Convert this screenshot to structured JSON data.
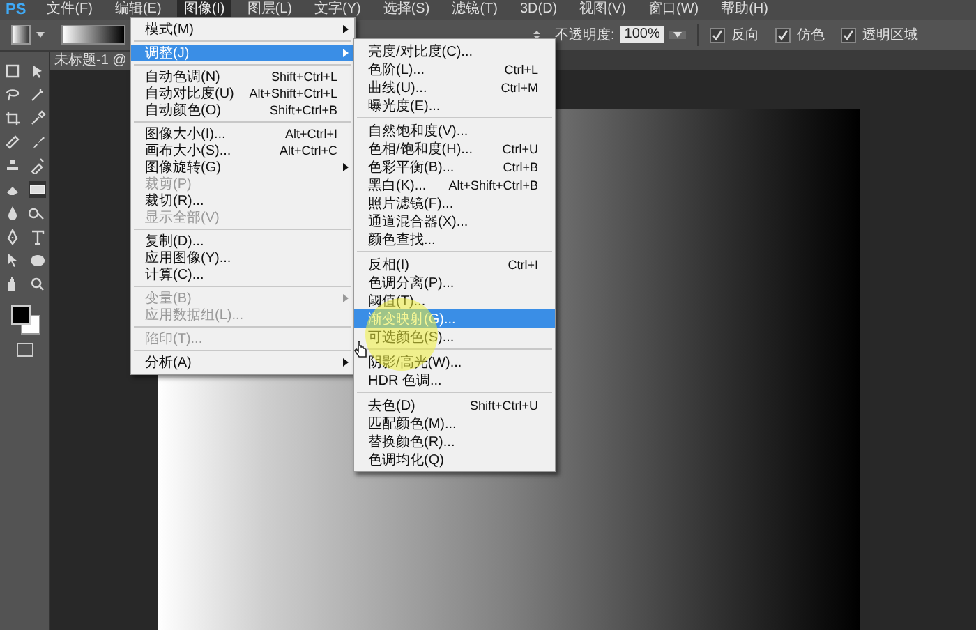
{
  "app_logo": "PS",
  "menu_bar": [
    {
      "label": "文件(F)",
      "selected": false
    },
    {
      "label": "编辑(E)",
      "selected": false
    },
    {
      "label": "图像(I)",
      "selected": true
    },
    {
      "label": "图层(L)",
      "selected": false
    },
    {
      "label": "文字(Y)",
      "selected": false
    },
    {
      "label": "选择(S)",
      "selected": false
    },
    {
      "label": "滤镜(T)",
      "selected": false
    },
    {
      "label": "3D(D)",
      "selected": false
    },
    {
      "label": "视图(V)",
      "selected": false
    },
    {
      "label": "窗口(W)",
      "selected": false
    },
    {
      "label": "帮助(H)",
      "selected": false
    }
  ],
  "options_bar": {
    "opacity_label": "不透明度:",
    "opacity_value": "100%",
    "checkboxes": [
      {
        "label": "反向",
        "checked": true
      },
      {
        "label": "仿色",
        "checked": true
      },
      {
        "label": "透明区域",
        "checked": true
      }
    ]
  },
  "document_tab": {
    "title": "未标题-1 @"
  },
  "image_menu": {
    "items": [
      {
        "label": "模式(M)",
        "submenu": true,
        "disabled": false,
        "selected": false
      },
      {
        "kind": "separator"
      },
      {
        "label": "调整(J)",
        "submenu": true,
        "disabled": false,
        "selected": true
      },
      {
        "kind": "separator"
      },
      {
        "label": "自动色调(N)",
        "shortcut": "Shift+Ctrl+L",
        "disabled": false,
        "selected": false
      },
      {
        "label": "自动对比度(U)",
        "shortcut": "Alt+Shift+Ctrl+L",
        "disabled": false,
        "selected": false
      },
      {
        "label": "自动颜色(O)",
        "shortcut": "Shift+Ctrl+B",
        "disabled": false,
        "selected": false
      },
      {
        "kind": "separator"
      },
      {
        "label": "图像大小(I)...",
        "shortcut": "Alt+Ctrl+I",
        "disabled": false,
        "selected": false
      },
      {
        "label": "画布大小(S)...",
        "shortcut": "Alt+Ctrl+C",
        "disabled": false,
        "selected": false
      },
      {
        "label": "图像旋转(G)",
        "submenu": true,
        "disabled": false,
        "selected": false
      },
      {
        "label": "裁剪(P)",
        "disabled": true,
        "selected": false
      },
      {
        "label": "裁切(R)...",
        "disabled": false,
        "selected": false
      },
      {
        "label": "显示全部(V)",
        "disabled": true,
        "selected": false
      },
      {
        "kind": "separator"
      },
      {
        "label": "复制(D)...",
        "disabled": false,
        "selected": false
      },
      {
        "label": "应用图像(Y)...",
        "disabled": false,
        "selected": false
      },
      {
        "label": "计算(C)...",
        "disabled": false,
        "selected": false
      },
      {
        "kind": "separator"
      },
      {
        "label": "变量(B)",
        "submenu": true,
        "disabled": true,
        "selected": false
      },
      {
        "label": "应用数据组(L)...",
        "disabled": true,
        "selected": false
      },
      {
        "kind": "separator"
      },
      {
        "label": "陷印(T)...",
        "disabled": true,
        "selected": false
      },
      {
        "kind": "separator"
      },
      {
        "label": "分析(A)",
        "submenu": true,
        "disabled": false,
        "selected": false
      }
    ]
  },
  "adjust_submenu": {
    "items": [
      {
        "label": "亮度/对比度(C)...",
        "disabled": false,
        "selected": false
      },
      {
        "label": "色阶(L)...",
        "shortcut": "Ctrl+L",
        "disabled": false,
        "selected": false
      },
      {
        "label": "曲线(U)...",
        "shortcut": "Ctrl+M",
        "disabled": false,
        "selected": false
      },
      {
        "label": "曝光度(E)...",
        "disabled": false,
        "selected": false
      },
      {
        "kind": "separator"
      },
      {
        "label": "自然饱和度(V)...",
        "disabled": false,
        "selected": false
      },
      {
        "label": "色相/饱和度(H)...",
        "shortcut": "Ctrl+U",
        "disabled": false,
        "selected": false
      },
      {
        "label": "色彩平衡(B)...",
        "shortcut": "Ctrl+B",
        "disabled": false,
        "selected": false
      },
      {
        "label": "黑白(K)...",
        "shortcut": "Alt+Shift+Ctrl+B",
        "disabled": false,
        "selected": false
      },
      {
        "label": "照片滤镜(F)...",
        "disabled": false,
        "selected": false
      },
      {
        "label": "通道混合器(X)...",
        "disabled": false,
        "selected": false
      },
      {
        "label": "颜色查找...",
        "disabled": false,
        "selected": false
      },
      {
        "kind": "separator"
      },
      {
        "label": "反相(I)",
        "shortcut": "Ctrl+I",
        "disabled": false,
        "selected": false
      },
      {
        "label": "色调分离(P)...",
        "disabled": false,
        "selected": false
      },
      {
        "label": "阈值(T)...",
        "disabled": false,
        "selected": false
      },
      {
        "label": "渐变映射(G)...",
        "disabled": false,
        "selected": true
      },
      {
        "label": "可选颜色(S)...",
        "disabled": false,
        "selected": false
      },
      {
        "kind": "separator"
      },
      {
        "label": "阴影/高光(W)...",
        "disabled": false,
        "selected": false
      },
      {
        "label": "HDR 色调...",
        "disabled": false,
        "selected": false
      },
      {
        "kind": "separator"
      },
      {
        "label": "去色(D)",
        "shortcut": "Shift+Ctrl+U",
        "disabled": false,
        "selected": false
      },
      {
        "label": "匹配颜色(M)...",
        "disabled": false,
        "selected": false
      },
      {
        "label": "替换颜色(R)...",
        "disabled": false,
        "selected": false
      },
      {
        "label": "色调均化(Q)",
        "disabled": false,
        "selected": false
      }
    ]
  }
}
